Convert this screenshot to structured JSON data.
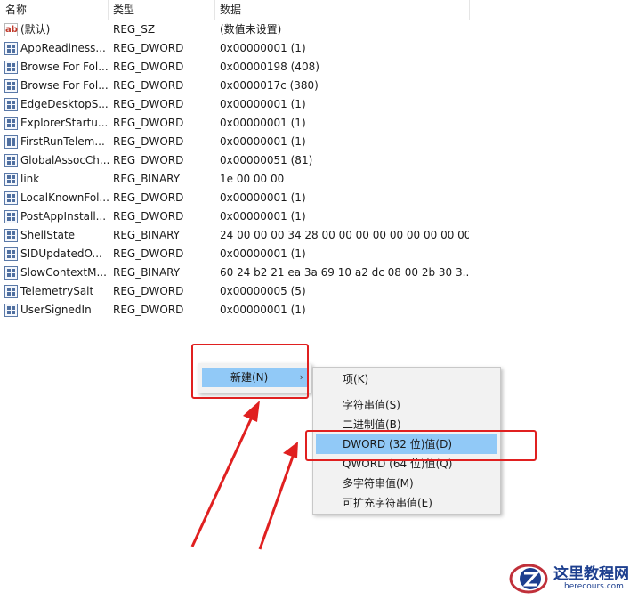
{
  "columns": {
    "name": "名称",
    "type": "类型",
    "data": "数据"
  },
  "rows": [
    {
      "name": "(默认)",
      "type": "REG_SZ",
      "data": "(数值未设置)",
      "icon": "string-value-icon"
    },
    {
      "name": "AppReadiness...",
      "type": "REG_DWORD",
      "data": "0x00000001 (1)",
      "icon": "binary-value-icon"
    },
    {
      "name": "Browse For Fol...",
      "type": "REG_DWORD",
      "data": "0x00000198 (408)",
      "icon": "binary-value-icon"
    },
    {
      "name": "Browse For Fol...",
      "type": "REG_DWORD",
      "data": "0x0000017c (380)",
      "icon": "binary-value-icon"
    },
    {
      "name": "EdgeDesktopS...",
      "type": "REG_DWORD",
      "data": "0x00000001 (1)",
      "icon": "binary-value-icon"
    },
    {
      "name": "ExplorerStartu...",
      "type": "REG_DWORD",
      "data": "0x00000001 (1)",
      "icon": "binary-value-icon"
    },
    {
      "name": "FirstRunTelem...",
      "type": "REG_DWORD",
      "data": "0x00000001 (1)",
      "icon": "binary-value-icon"
    },
    {
      "name": "GlobalAssocCh...",
      "type": "REG_DWORD",
      "data": "0x00000051 (81)",
      "icon": "binary-value-icon"
    },
    {
      "name": "link",
      "type": "REG_BINARY",
      "data": "1e 00 00 00",
      "icon": "binary-value-icon"
    },
    {
      "name": "LocalKnownFol...",
      "type": "REG_DWORD",
      "data": "0x00000001 (1)",
      "icon": "binary-value-icon"
    },
    {
      "name": "PostAppInstall...",
      "type": "REG_DWORD",
      "data": "0x00000001 (1)",
      "icon": "binary-value-icon"
    },
    {
      "name": "ShellState",
      "type": "REG_BINARY",
      "data": "24 00 00 00 34 28 00 00 00 00 00 00 00 00 00...",
      "icon": "binary-value-icon"
    },
    {
      "name": "SIDUpdatedO...",
      "type": "REG_DWORD",
      "data": "0x00000001 (1)",
      "icon": "binary-value-icon"
    },
    {
      "name": "SlowContextM...",
      "type": "REG_BINARY",
      "data": "60 24 b2 21 ea 3a 69 10 a2 dc 08 00 2b 30 3...",
      "icon": "binary-value-icon"
    },
    {
      "name": "TelemetrySalt",
      "type": "REG_DWORD",
      "data": "0x00000005 (5)",
      "icon": "binary-value-icon"
    },
    {
      "name": "UserSignedIn",
      "type": "REG_DWORD",
      "data": "0x00000001 (1)",
      "icon": "binary-value-icon"
    }
  ],
  "context_menu": {
    "new_label": "新建(N)",
    "submenu_arrow": "›"
  },
  "submenu": {
    "key": "项(K)",
    "string_value": "字符串值(S)",
    "binary_value": "二进制值(B)",
    "dword_value": "DWORD (32 位)值(D)",
    "qword_value": "QWORD (64 位)值(Q)",
    "multi_string_value": "多字符串值(M)",
    "expandable_string_value": "可扩充字符串值(E)"
  },
  "watermark": {
    "title": "这里教程网",
    "url": "herecours.com"
  },
  "colors": {
    "highlight": "#91c9f7",
    "annotation_red": "#e02020",
    "watermark_blue": "#1d3f8f"
  }
}
